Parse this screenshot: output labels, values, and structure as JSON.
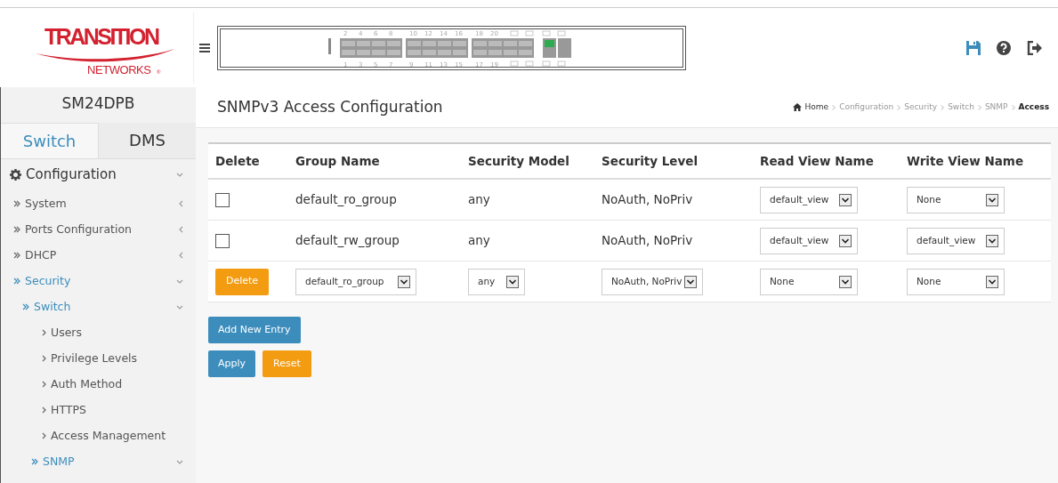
{
  "logo": {
    "title": "TRANSITION",
    "subtitle": "NETWORKS",
    "mark": "®"
  },
  "switch_panel": {
    "top_ports": [
      "2",
      "4",
      "6",
      "8",
      "10",
      "12",
      "14",
      "16",
      "18",
      "20"
    ],
    "bottom_ports": [
      "1",
      "3",
      "5",
      "7",
      "9",
      "11",
      "13",
      "15",
      "17",
      "19"
    ]
  },
  "sidebar": {
    "device": "SM24DPB",
    "tabs": [
      {
        "label": "Switch",
        "selected": true
      },
      {
        "label": "DMS",
        "selected": false
      }
    ],
    "items": [
      {
        "label": "Configuration",
        "kind": "root",
        "expanded": true,
        "selected": false,
        "children": [
          {
            "label": "System",
            "kind": "group",
            "expanded": false,
            "selected": false
          },
          {
            "label": "Ports Configuration",
            "kind": "group",
            "expanded": false,
            "selected": false
          },
          {
            "label": "DHCP",
            "kind": "group",
            "expanded": false,
            "selected": false
          },
          {
            "label": "Security",
            "kind": "group",
            "expanded": true,
            "selected": true,
            "children": [
              {
                "label": "Switch",
                "kind": "group",
                "expanded": true,
                "selected": true,
                "children": [
                  {
                    "label": "Users",
                    "kind": "page",
                    "selected": false
                  },
                  {
                    "label": "Privilege Levels",
                    "kind": "page",
                    "selected": false
                  },
                  {
                    "label": "Auth Method",
                    "kind": "page",
                    "selected": false
                  },
                  {
                    "label": "HTTPS",
                    "kind": "page",
                    "selected": false
                  },
                  {
                    "label": "Access Management",
                    "kind": "page",
                    "selected": false
                  },
                  {
                    "label": "SNMP",
                    "kind": "group",
                    "expanded": true,
                    "selected": true
                  }
                ]
              }
            ]
          }
        ]
      }
    ]
  },
  "page": {
    "title": "SNMPv3 Access Configuration",
    "breadcrumb": [
      {
        "label": "Home",
        "selected": false
      },
      {
        "label": "Configuration",
        "selected": false
      },
      {
        "label": "Security",
        "selected": false
      },
      {
        "label": "Switch",
        "selected": false
      },
      {
        "label": "SNMP",
        "selected": false
      },
      {
        "label": "Access",
        "selected": true
      }
    ]
  },
  "table": {
    "columns": [
      "Delete",
      "Group Name",
      "Security Model",
      "Security Level",
      "Read View Name",
      "Write View Name"
    ],
    "rows": [
      {
        "kind": "existing",
        "checked": false,
        "group": "default_ro_group",
        "model": "any",
        "level": "NoAuth, NoPriv",
        "read_view": "default_view",
        "write_view": "None"
      },
      {
        "kind": "existing",
        "checked": false,
        "group": "default_rw_group",
        "model": "any",
        "level": "NoAuth, NoPriv",
        "read_view": "default_view",
        "write_view": "default_view"
      },
      {
        "kind": "new",
        "delete_label": "Delete",
        "group": "default_ro_group",
        "model": "any",
        "level": "NoAuth, NoPriv",
        "read_view": "None",
        "write_view": "None"
      }
    ]
  },
  "buttons": {
    "add": "Add New Entry",
    "apply": "Apply",
    "reset": "Reset"
  }
}
